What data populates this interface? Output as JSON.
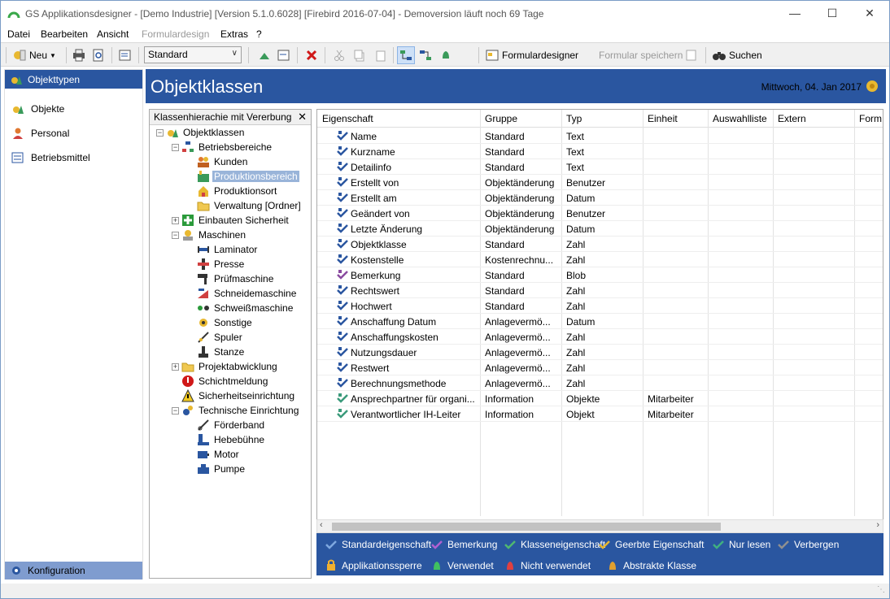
{
  "window": {
    "title": "GS Applikationsdesigner - [Demo Industrie]  [Version 5.1.0.6028]  [Firebird 2016-07-04] - Demoversion läuft noch 69 Tage"
  },
  "menu": [
    "Datei",
    "Bearbeiten",
    "Ansicht",
    "Formulardesign",
    "Extras",
    "?"
  ],
  "toolbar": {
    "new_label": "Neu",
    "combo_value": "Standard",
    "formdesigner_label": "Formulardesigner",
    "save_form_label": "Formular speichern",
    "search_label": "Suchen"
  },
  "nav": {
    "active": "Objekttypen",
    "items": [
      "Objekte",
      "Personal",
      "Betriebsmittel"
    ],
    "bottom": "Konfiguration"
  },
  "header": {
    "title": "Objektklassen",
    "date": "Mittwoch, 04. Jan 2017"
  },
  "tree": {
    "title": "Klassenhierachie mit Vererbung",
    "nodes": [
      "Objektklassen",
      "Betriebsbereiche",
      "Kunden",
      "Produktionsbereich",
      "Produktionsort",
      "Verwaltung [Ordner]",
      "Einbauten Sicherheit",
      "Maschinen",
      "Laminator",
      "Presse",
      "Prüfmaschine",
      "Schneidemaschine",
      "Schweißmaschine",
      "Sonstige",
      "Spuler",
      "Stanze",
      "Projektabwicklung",
      "Schichtmeldung",
      "Sicherheitseinrichtung",
      "Technische Einrichtung",
      "Förderband",
      "Hebebühne",
      "Motor",
      "Pumpe"
    ]
  },
  "grid": {
    "columns": [
      "Eigenschaft",
      "Gruppe",
      "Typ",
      "Einheit",
      "Auswahlliste",
      "Extern",
      "Form"
    ],
    "rows": [
      [
        "Name",
        "Standard",
        "Text",
        ""
      ],
      [
        "Kurzname",
        "Standard",
        "Text",
        ""
      ],
      [
        "Detailinfo",
        "Standard",
        "Text",
        ""
      ],
      [
        "Erstellt von",
        "Objektänderung",
        "Benutzer",
        ""
      ],
      [
        "Erstellt am",
        "Objektänderung",
        "Datum",
        ""
      ],
      [
        "Geändert von",
        "Objektänderung",
        "Benutzer",
        ""
      ],
      [
        "Letzte Änderung",
        "Objektänderung",
        "Datum",
        ""
      ],
      [
        "Objektklasse",
        "Standard",
        "Zahl",
        ""
      ],
      [
        "Kostenstelle",
        "Kostenrechnu...",
        "Zahl",
        ""
      ],
      [
        "Bemerkung",
        "Standard",
        "Blob",
        ""
      ],
      [
        "Rechtswert",
        "Standard",
        "Zahl",
        ""
      ],
      [
        "Hochwert",
        "Standard",
        "Zahl",
        ""
      ],
      [
        "Anschaffung Datum",
        "Anlagevermö...",
        "Datum",
        ""
      ],
      [
        "Anschaffungskosten",
        "Anlagevermö...",
        "Zahl",
        ""
      ],
      [
        "Nutzungsdauer",
        "Anlagevermö...",
        "Zahl",
        ""
      ],
      [
        "Restwert",
        "Anlagevermö...",
        "Zahl",
        ""
      ],
      [
        "Berechnungsmethode",
        "Anlagevermö...",
        "Zahl",
        ""
      ],
      [
        "Ansprechpartner für organi...",
        "Information",
        "Objekte",
        "Mitarbeiter"
      ],
      [
        "Verantwortlicher IH-Leiter",
        "Information",
        "Objekt",
        "Mitarbeiter"
      ]
    ]
  },
  "legend": [
    "Standardeigenschaft",
    "Bemerkung",
    "Klasseneigenschaft",
    "Geerbte Eigenschaft",
    "Nur lesen",
    "Verbergen",
    "Applikationssperre",
    "Verwendet",
    "Nicht verwendet",
    "Abstrakte Klasse"
  ]
}
